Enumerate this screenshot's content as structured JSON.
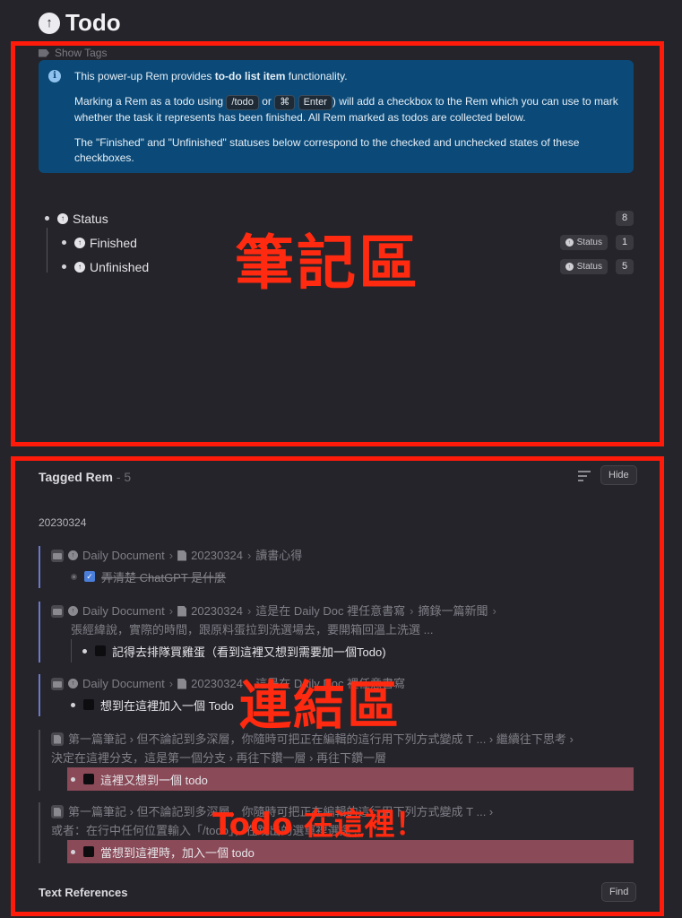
{
  "page": {
    "title": "Todo",
    "show_tags": "Show Tags"
  },
  "info": {
    "p1_a": "This power-up Rem provides ",
    "p1_b": "to-do list item",
    "p1_c": " functionality.",
    "p2_a": "Marking a Rem as a todo using ",
    "p2_kbd1": "/todo",
    "p2_or": " or ",
    "p2_kbd2": "⌘",
    "p2_kbd3": "Enter",
    "p2_b": ") will add a checkbox to the Rem which you can use to mark whether the task it represents has been finished. All Rem marked as todos are collected below.",
    "p3": "The \"Finished\" and \"Unfinished\" statuses below correspond to the checked and unchecked states of these checkboxes."
  },
  "status": {
    "root_label": "Status",
    "root_count": "8",
    "children": [
      {
        "label": "Finished",
        "chip": "Status",
        "count": "1"
      },
      {
        "label": "Unfinished",
        "chip": "Status",
        "count": "5"
      }
    ]
  },
  "annotations": {
    "notes_area": "筆記區",
    "link_area": "連結區",
    "todo_here": "Todo 在這裡！"
  },
  "tagged": {
    "title": "Tagged Rem",
    "count": " - 5",
    "hide": "Hide",
    "date": "20230324",
    "refs": [
      {
        "crumbs": [
          "Daily Document",
          "20230324",
          "讀書心得"
        ],
        "todo": "弄清楚 ChatGPT 是什麼",
        "done": true
      },
      {
        "crumbs": [
          "Daily Document",
          "20230324",
          "這是在 Daily Doc 裡任意書寫",
          "摘錄一篇新聞"
        ],
        "line2": "張經緯說，實際的時間，跟原料蛋拉到洗選場去，要開箱回溫上洗選 ...",
        "todo": "記得去排隊買雞蛋（看到這裡又想到需要加一個Todo)",
        "done": false
      },
      {
        "crumbs": [
          "Daily Document",
          "20230324",
          "這是在 Daily Doc 裡任意書寫"
        ],
        "todo": "想到在這裡加入一個 Todo",
        "done": false
      },
      {
        "line1": "第一篇筆記 › 但不論記到多深層，你隨時可把正在編輯的這行用下列方式變成 T ... › 繼續往下思考 ›",
        "line2": "決定在這裡分支，這是第一個分支 › 再往下鑽一層 › 再往下鑽一層",
        "todo": "這裡又想到一個 todo",
        "done": false
      },
      {
        "line1": "第一篇筆記 › 但不論記到多深層，你隨時可把正在編輯的這行用下列方式變成 T ... ›",
        "line2": "或者：在行中任何位置輸入「/todo」，在跳出的選單裡選擇 ...",
        "todo": "當想到這裡時，加入一個 todo",
        "done": false
      }
    ]
  },
  "text_references": {
    "title": "Text References",
    "find": "Find"
  }
}
